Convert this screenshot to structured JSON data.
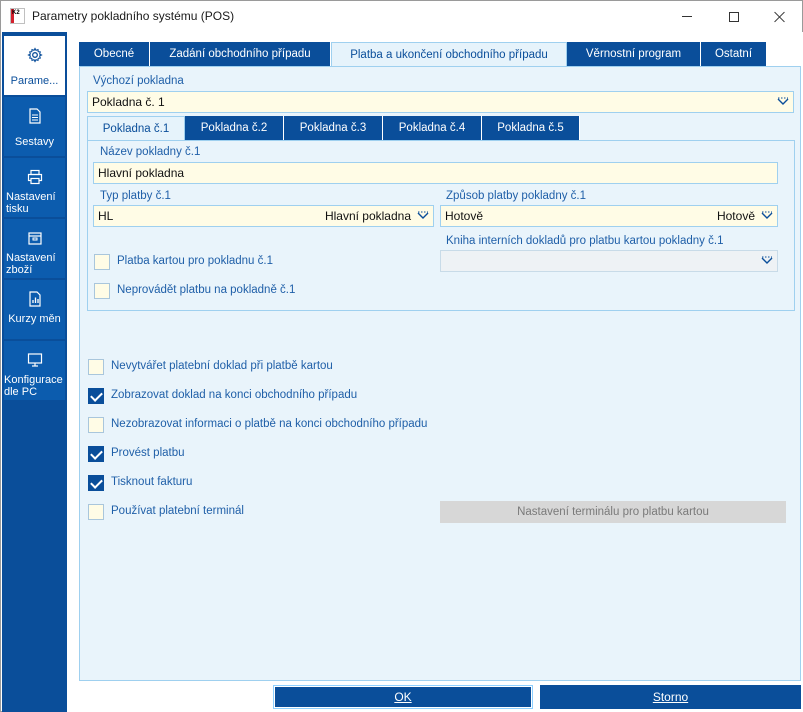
{
  "window": {
    "title": "Parametry pokladního systému (POS)",
    "app_icon_text": "K2"
  },
  "sidebar": {
    "items": [
      {
        "label": "Parame...",
        "icon": "gear-icon",
        "active": true
      },
      {
        "label": "Sestavy",
        "icon": "document-icon",
        "active": false
      },
      {
        "label": "Nastavení tisku",
        "icon": "printer-icon",
        "active": false
      },
      {
        "label": "Nastavení zboží",
        "icon": "package-icon",
        "active": false
      },
      {
        "label": "Kurzy měn",
        "icon": "chart-icon",
        "active": false
      },
      {
        "label": "Konfigurace dle PC",
        "icon": "monitor-icon",
        "active": false
      }
    ]
  },
  "tabs": [
    {
      "label": "Obecné",
      "active": false
    },
    {
      "label": "Zadání obchodního případu",
      "active": false
    },
    {
      "label": "Platba a ukončení obchodního případu",
      "active": true
    },
    {
      "label": "Věrnostní program",
      "active": false
    },
    {
      "label": "Ostatní",
      "active": false
    }
  ],
  "default_register": {
    "label": "Výchozí pokladna",
    "value": "Pokladna č. 1"
  },
  "subtabs": [
    {
      "label": "Pokladna č.1",
      "active": true
    },
    {
      "label": "Pokladna č.2",
      "active": false
    },
    {
      "label": "Pokladna č.3",
      "active": false
    },
    {
      "label": "Pokladna č.4",
      "active": false
    },
    {
      "label": "Pokladna č.5",
      "active": false
    }
  ],
  "register": {
    "name_label": "Název pokladny č.1",
    "name_value": "Hlavní pokladna",
    "payment_type_label": "Typ platby č.1",
    "payment_type_code": "HL",
    "payment_type_name": "Hlavní pokladna",
    "payment_method_label": "Způsob platby pokladny č.1",
    "payment_method_code": "Hotově",
    "payment_method_name": "Hotově",
    "card_book_label": "Kniha interních dokladů pro platbu kartou pokladny č.1",
    "card_book_value": "",
    "card_payment_label": "Platba kartou pro pokladnu č.1",
    "card_payment_checked": false,
    "no_payment_label": "Neprovádět platbu na pokladně č.1",
    "no_payment_checked": false
  },
  "options": [
    {
      "label": "Nevytvářet platební doklad při platbě kartou",
      "checked": false
    },
    {
      "label": "Zobrazovat doklad na konci obchodního případu",
      "checked": true
    },
    {
      "label": "Nezobrazovat informaci o platbě na konci obchodního případu",
      "checked": false
    },
    {
      "label": "Provést platbu",
      "checked": true
    },
    {
      "label": "Tisknout fakturu",
      "checked": true
    },
    {
      "label": "Používat platební terminál",
      "checked": false
    }
  ],
  "terminal_button": "Nastavení terminálu pro platbu kartou",
  "footer": {
    "ok": "OK",
    "cancel": "Storno"
  },
  "colors": {
    "accent": "#0a4e9a",
    "panel": "#e9f4fb",
    "field": "#fffce6",
    "label": "#1f5fa8"
  }
}
